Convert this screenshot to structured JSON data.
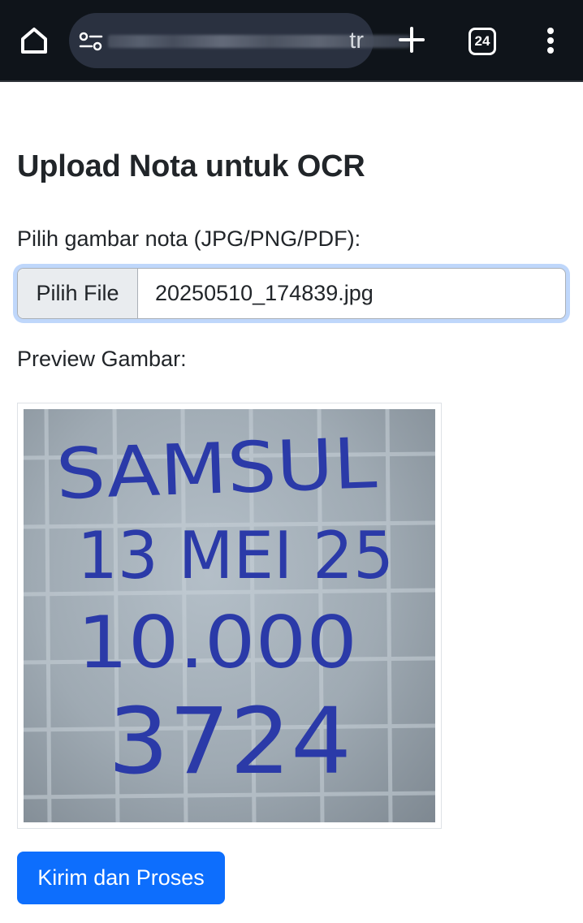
{
  "browser": {
    "url_visible_tail": "tr",
    "tab_count": "24"
  },
  "page": {
    "title": "Upload Nota untuk OCR",
    "file_label": "Pilih gambar nota (JPG/PNG/PDF):",
    "file_button_label": "Pilih File",
    "file_name": "20250510_174839.jpg",
    "preview_label": "Preview Gambar:",
    "preview_handwriting": [
      "SAMSUL",
      "13 MEI 25",
      "10.000",
      "3724"
    ],
    "submit_label": "Kirim dan Proses"
  },
  "colors": {
    "toolbar_bg": "#0f141a",
    "primary_button": "#0d6efd",
    "focus_ring": "#bfd7fb",
    "ink": "#2b3aa8"
  }
}
